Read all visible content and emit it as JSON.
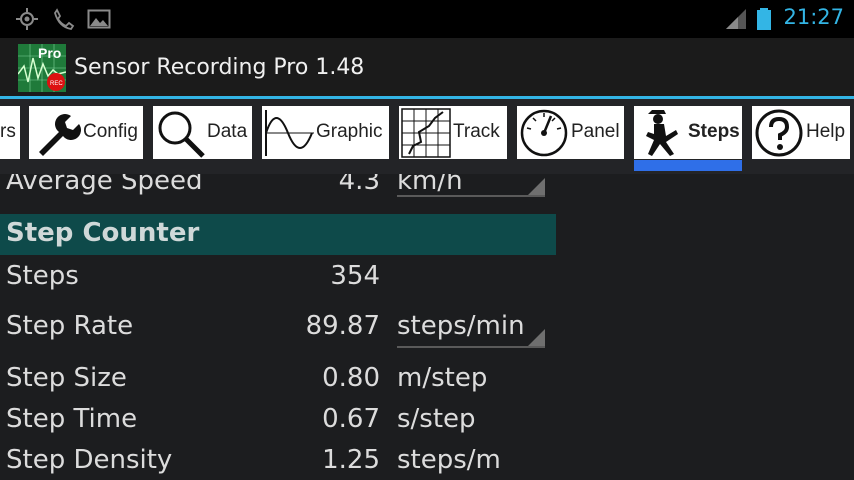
{
  "status_bar": {
    "time": "21:27",
    "icons": [
      "gps-icon",
      "missed-call-icon",
      "picture-icon",
      "signal-icon",
      "battery-icon"
    ]
  },
  "app": {
    "title": "Sensor Recording Pro 1.48",
    "logo_text": "Pro",
    "logo_badge": "REC"
  },
  "tabs": [
    {
      "label": "rs",
      "icon": "sensors-icon",
      "selected": false
    },
    {
      "label": "Config",
      "icon": "wrench-icon",
      "selected": false
    },
    {
      "label": "Data",
      "icon": "magnifier-icon",
      "selected": false
    },
    {
      "label": "Graphic",
      "icon": "sine-wave-icon",
      "selected": false
    },
    {
      "label": "Track",
      "icon": "track-map-icon",
      "selected": false
    },
    {
      "label": "Panel",
      "icon": "gauge-icon",
      "selected": false
    },
    {
      "label": "Steps",
      "icon": "walking-man-icon",
      "selected": true
    },
    {
      "label": "Help",
      "icon": "help-icon",
      "selected": false
    }
  ],
  "content": {
    "avg_speed": {
      "label": "Average Speed",
      "value": "4.3",
      "unit": "km/h"
    },
    "section_title": "Step Counter",
    "rows": [
      {
        "label": "Steps",
        "value": "354",
        "unit": ""
      },
      {
        "label": "Step Rate",
        "value": "89.87",
        "unit": "steps/min"
      },
      {
        "label": "Step Size",
        "value": "0.80",
        "unit": "m/step"
      },
      {
        "label": "Step Time",
        "value": "0.67",
        "unit": "s/step"
      },
      {
        "label": "Step Density",
        "value": "1.25",
        "unit": "steps/m"
      }
    ]
  },
  "colors": {
    "accent": "#33b5e5",
    "tab_indicator": "#2f6fe8",
    "section_bg": "#0e4a4a"
  }
}
